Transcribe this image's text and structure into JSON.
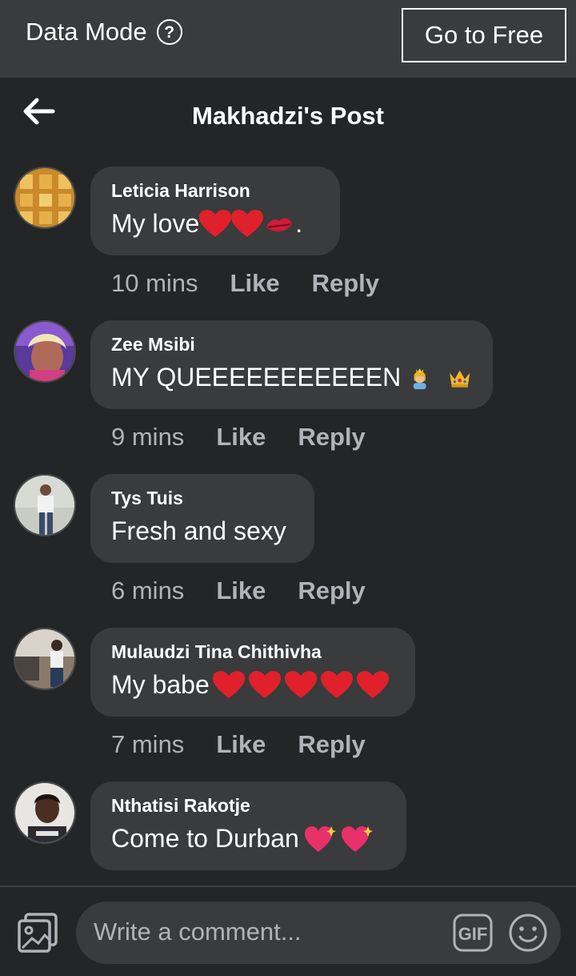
{
  "topbar": {
    "data_mode_label": "Data Mode",
    "go_free_label": "Go to Free"
  },
  "header": {
    "title": "Makhadzi's Post"
  },
  "comments": [
    {
      "author": "Leticia Harrison",
      "text": "My love",
      "time": "10 mins",
      "like": "Like",
      "reply": "Reply",
      "emoji": [
        "heart",
        "heart",
        "kiss"
      ],
      "trailing": "."
    },
    {
      "author": "Zee Msibi",
      "text": "MY QUEEEEEEEEEEEN ",
      "time": "9 mins",
      "like": "Like",
      "reply": "Reply",
      "emoji": [
        "princess",
        "crown"
      ],
      "trailing": ""
    },
    {
      "author": "Tys Tuis",
      "text": "Fresh and sexy",
      "time": "6 mins",
      "like": "Like",
      "reply": "Reply",
      "emoji": [],
      "trailing": ""
    },
    {
      "author": "Mulaudzi Tina Chithivha",
      "text": "My babe",
      "time": "7 mins",
      "like": "Like",
      "reply": "Reply",
      "emoji": [
        "heart",
        "heart",
        "heart",
        "heart",
        "heart"
      ],
      "trailing": ""
    },
    {
      "author": "Nthatisi Rakotje",
      "text": "Come to Durban ",
      "time": "",
      "like": "",
      "reply": "",
      "emoji": [
        "sparkle-heart",
        "sparkle-heart"
      ],
      "trailing": ""
    }
  ],
  "composer": {
    "placeholder": "Write a comment...",
    "gif_label": "GIF"
  },
  "icons": {
    "back": "arrow-left-icon",
    "help": "question-circle-icon",
    "photo": "photo-icon",
    "smile": "smile-icon"
  },
  "colors": {
    "background": "#242526",
    "bubble": "#3a3b3c",
    "topbar": "#3a3b3c",
    "muted": "#b0b3b8"
  }
}
